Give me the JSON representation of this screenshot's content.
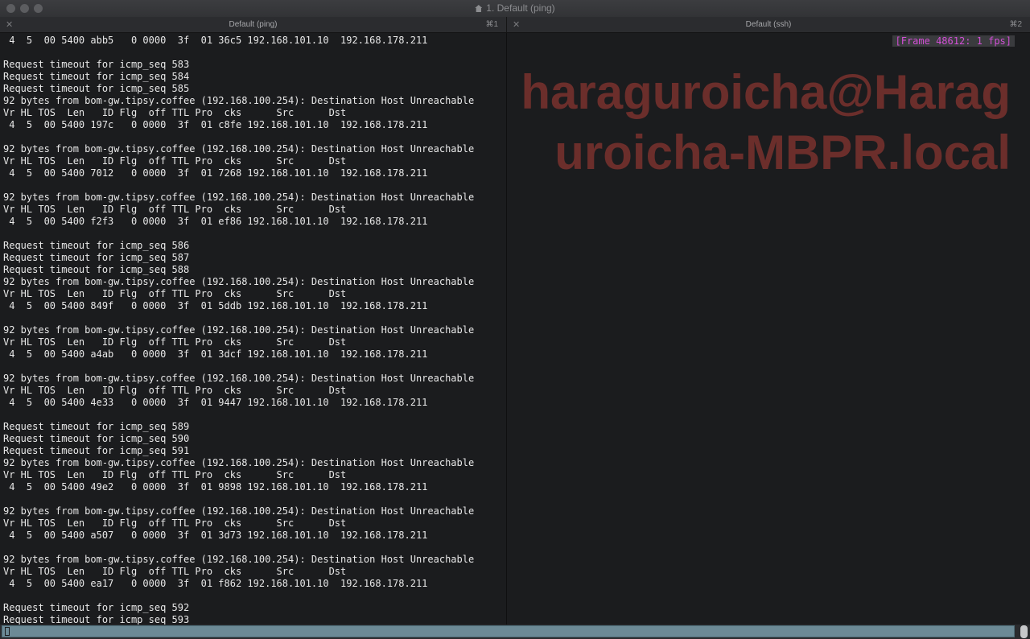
{
  "window": {
    "title": "1. Default (ping)"
  },
  "tabs": [
    {
      "label": "Default (ping)",
      "shortcut": "⌘1"
    },
    {
      "label": "Default (ssh)",
      "shortcut": "⌘2"
    }
  ],
  "left_pane": {
    "lines": [
      " 4  5  00 5400 abb5   0 0000  3f  01 36c5 192.168.101.10  192.168.178.211",
      "",
      "Request timeout for icmp_seq 583",
      "Request timeout for icmp_seq 584",
      "Request timeout for icmp_seq 585",
      "92 bytes from bom-gw.tipsy.coffee (192.168.100.254): Destination Host Unreachable",
      "Vr HL TOS  Len   ID Flg  off TTL Pro  cks      Src      Dst",
      " 4  5  00 5400 197c   0 0000  3f  01 c8fe 192.168.101.10  192.168.178.211",
      "",
      "92 bytes from bom-gw.tipsy.coffee (192.168.100.254): Destination Host Unreachable",
      "Vr HL TOS  Len   ID Flg  off TTL Pro  cks      Src      Dst",
      " 4  5  00 5400 7012   0 0000  3f  01 7268 192.168.101.10  192.168.178.211",
      "",
      "92 bytes from bom-gw.tipsy.coffee (192.168.100.254): Destination Host Unreachable",
      "Vr HL TOS  Len   ID Flg  off TTL Pro  cks      Src      Dst",
      " 4  5  00 5400 f2f3   0 0000  3f  01 ef86 192.168.101.10  192.168.178.211",
      "",
      "Request timeout for icmp_seq 586",
      "Request timeout for icmp_seq 587",
      "Request timeout for icmp_seq 588",
      "92 bytes from bom-gw.tipsy.coffee (192.168.100.254): Destination Host Unreachable",
      "Vr HL TOS  Len   ID Flg  off TTL Pro  cks      Src      Dst",
      " 4  5  00 5400 849f   0 0000  3f  01 5ddb 192.168.101.10  192.168.178.211",
      "",
      "92 bytes from bom-gw.tipsy.coffee (192.168.100.254): Destination Host Unreachable",
      "Vr HL TOS  Len   ID Flg  off TTL Pro  cks      Src      Dst",
      " 4  5  00 5400 a4ab   0 0000  3f  01 3dcf 192.168.101.10  192.168.178.211",
      "",
      "92 bytes from bom-gw.tipsy.coffee (192.168.100.254): Destination Host Unreachable",
      "Vr HL TOS  Len   ID Flg  off TTL Pro  cks      Src      Dst",
      " 4  5  00 5400 4e33   0 0000  3f  01 9447 192.168.101.10  192.168.178.211",
      "",
      "Request timeout for icmp_seq 589",
      "Request timeout for icmp_seq 590",
      "Request timeout for icmp_seq 591",
      "92 bytes from bom-gw.tipsy.coffee (192.168.100.254): Destination Host Unreachable",
      "Vr HL TOS  Len   ID Flg  off TTL Pro  cks      Src      Dst",
      " 4  5  00 5400 49e2   0 0000  3f  01 9898 192.168.101.10  192.168.178.211",
      "",
      "92 bytes from bom-gw.tipsy.coffee (192.168.100.254): Destination Host Unreachable",
      "Vr HL TOS  Len   ID Flg  off TTL Pro  cks      Src      Dst",
      " 4  5  00 5400 a507   0 0000  3f  01 3d73 192.168.101.10  192.168.178.211",
      "",
      "92 bytes from bom-gw.tipsy.coffee (192.168.100.254): Destination Host Unreachable",
      "Vr HL TOS  Len   ID Flg  off TTL Pro  cks      Src      Dst",
      " 4  5  00 5400 ea17   0 0000  3f  01 f862 192.168.101.10  192.168.178.211",
      "",
      "Request timeout for icmp_seq 592",
      "Request timeout for icmp_seq 593"
    ]
  },
  "right_pane": {
    "frame_badge": "[Frame 48612: 1 fps]",
    "hostname_line1": "haraguroicha@Harag",
    "hostname_line2": "uroicha-MBPR.local"
  },
  "colors": {
    "background": "#1b1c1e",
    "text": "#e8e8e8",
    "badge_text": "#d24fd6",
    "hostname": "#6b2e2b",
    "input_strip": "#6c8a96"
  }
}
